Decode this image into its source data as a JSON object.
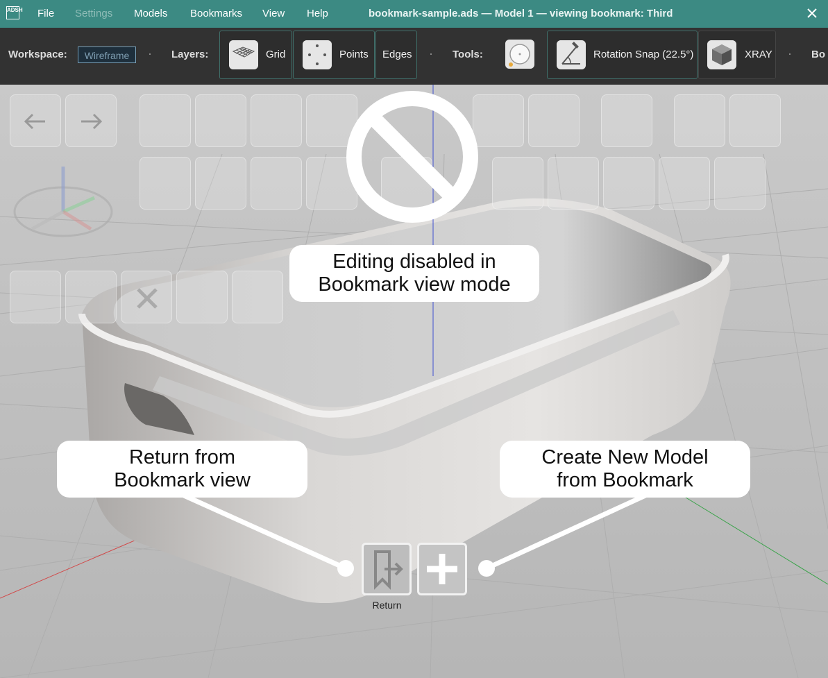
{
  "titlebar": {
    "logo_text": "ADSH",
    "menus": [
      "File",
      "Settings",
      "Models",
      "Bookmarks",
      "View",
      "Help"
    ],
    "title": "bookmark-sample.ads — Model 1 — viewing bookmark: Third",
    "colors": {
      "background": "#3c8a83",
      "disabled_menu": "#8fbcb7"
    }
  },
  "toolbar": {
    "workspace_label": "Workspace:",
    "workspace_value": "Wireframe",
    "layers_label": "Layers:",
    "grid_label": "Grid",
    "points_label": "Points",
    "edges_label": "Edges",
    "tools_label": "Tools:",
    "rotation_snap_label": "Rotation Snap (22.5°)",
    "xray_label": "XRAY",
    "overflow_label": "Bo"
  },
  "viewport": {
    "icons": [
      "no-entry-icon",
      "bookmark-return-icon",
      "plus-icon"
    ],
    "disabled_message": "Editing disabled in Bookmark view mode",
    "disabled_message_line1": "Editing disabled in",
    "disabled_message_line2": "Bookmark view mode",
    "return_callout_line1": "Return from",
    "return_callout_line2": "Bookmark view",
    "create_callout_line1": "Create New Model",
    "create_callout_line2": "from Bookmark",
    "return_button_label": "Return"
  }
}
